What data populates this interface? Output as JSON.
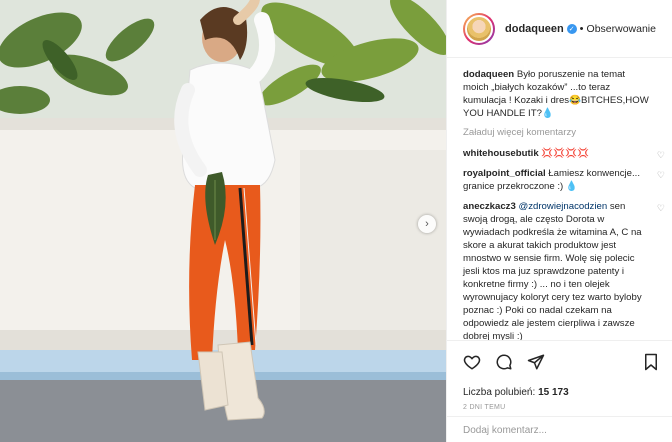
{
  "post": {
    "username": "dodaqueen",
    "follow_label": "Obserwowanie",
    "separator": "•",
    "verified_icon": "verified-badge-icon",
    "accent_color": "#3897f0"
  },
  "caption": {
    "username": "dodaqueen",
    "text": "Było poruszenie na temat moich „białych kozaków” ...to teraz kumulacja ! Kozaki i dres😂BITCHES,HOW YOU HANDLE IT?💧"
  },
  "load_more_label": "Załaduj więcej komentarzy",
  "comments": [
    {
      "username": "whitehousebutik",
      "text": "💢💢💢💢"
    },
    {
      "username": "royalpoint_official",
      "text": "Łamiesz konwencje... granice przekroczone :) 💧"
    },
    {
      "username": "aneczkacz3",
      "mention": "@zdrowiejnacodzien",
      "text": "sen swoją drogą, ale często Dorota w wywiadach podkreśla że witamina A, C na skore a akurat takich produktow jest mnostwo w sensie firm. Wolę się polecic jesli ktos ma juz sprawdzone patenty i konkretne firmy :) ... no i ten olejek wyrownujacy koloryt cery tez warto byloby poznac :) Poki co nadal czekam na odpowiedz ale jestem cierpliwa i zawsze dobrej mysli :)"
    }
  ],
  "likes": {
    "label": "Liczba polubień:",
    "count": "15 173"
  },
  "date": "2 DNI TEMU",
  "add_comment_placeholder": "Dodaj komentarz...",
  "icons": [
    "heart-icon",
    "comment-icon",
    "share-icon",
    "bookmark-icon",
    "chevron-right-icon"
  ]
}
